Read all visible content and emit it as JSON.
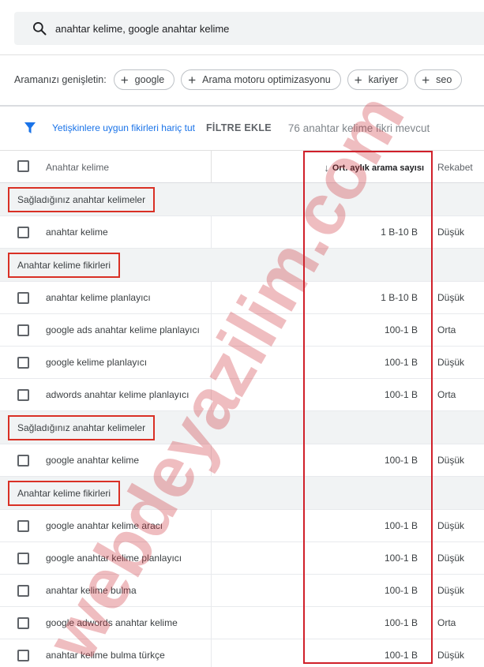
{
  "search": {
    "query": "anahtar kelime, google anahtar kelime"
  },
  "expand": {
    "label": "Aramanızı genişletin:",
    "chips": [
      "google",
      "Arama motoru optimizasyonu",
      "kariyer",
      "seo"
    ]
  },
  "filters": {
    "exclude_adult": "Yetişkinlere uygun fikirleri hariç tut",
    "add_filter": "FİLTRE EKLE",
    "count_text": "76 anahtar kelime fikri mevcut"
  },
  "table": {
    "headers": {
      "keyword": "Anahtar kelime",
      "avg_monthly": "Ort. aylık arama sayısı",
      "competition": "Rekabet"
    },
    "sections": [
      {
        "title": "Sağladığınız anahtar kelimeler",
        "rows": [
          {
            "keyword": "anahtar kelime",
            "avg": "1 B-10 B",
            "competition": "Düşük"
          }
        ]
      },
      {
        "title": "Anahtar kelime fikirleri",
        "rows": [
          {
            "keyword": "anahtar kelime planlayıcı",
            "avg": "1 B-10 B",
            "competition": "Düşük"
          },
          {
            "keyword": "google ads anahtar kelime planlayıcı",
            "avg": "100-1 B",
            "competition": "Orta"
          },
          {
            "keyword": "google kelime planlayıcı",
            "avg": "100-1 B",
            "competition": "Düşük"
          },
          {
            "keyword": "adwords anahtar kelime planlayıcı",
            "avg": "100-1 B",
            "competition": "Orta"
          }
        ]
      },
      {
        "title": "Sağladığınız anahtar kelimeler",
        "rows": [
          {
            "keyword": "google anahtar kelime",
            "avg": "100-1 B",
            "competition": "Düşük"
          }
        ]
      },
      {
        "title": "Anahtar kelime fikirleri",
        "rows": [
          {
            "keyword": "google anahtar kelime aracı",
            "avg": "100-1 B",
            "competition": "Düşük"
          },
          {
            "keyword": "google anahtar kelime planlayıcı",
            "avg": "100-1 B",
            "competition": "Düşük"
          },
          {
            "keyword": "anahtar kelime bulma",
            "avg": "100-1 B",
            "competition": "Düşük"
          },
          {
            "keyword": "google adwords anahtar kelime",
            "avg": "100-1 B",
            "competition": "Orta"
          },
          {
            "keyword": "anahtar kelime bulma türkçe",
            "avg": "100-1 B",
            "competition": "Düşük"
          }
        ]
      }
    ]
  },
  "watermark": "webdeyazilim.com",
  "colors": {
    "accent": "#1a73e8",
    "highlight": "#d93025",
    "group_bg": "#f1f3f4"
  }
}
